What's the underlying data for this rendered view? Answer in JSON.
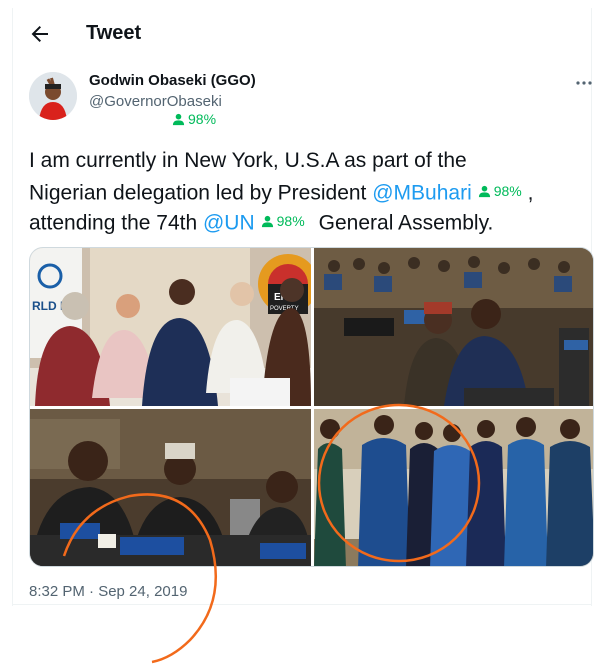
{
  "header": {
    "title": "Tweet",
    "back_icon": "back-arrow-icon"
  },
  "author": {
    "display_name": "Godwin Obaseki (GGO)",
    "handle": "@GovernorObaseki",
    "badge_percent": "98%",
    "more_icon": "more-dots-icon"
  },
  "tweet": {
    "line1": "I am currently in New York, U.S.A as part of the",
    "line2_prefix": "Nigerian delegation led by President ",
    "mention1": "@MBuhari",
    "mention1_badge": "98%",
    "line2_suffix": " ,",
    "line3_prefix": "attending the 74th ",
    "mention2": "@UN",
    "mention2_badge": "98%",
    "line3_suffix": "General Assembly."
  },
  "media": {
    "photo1_sign_left": "RLD BA",
    "photo1_sign_right_1": "END",
    "photo1_sign_right_2": "POVERTY"
  },
  "timestamp": "8:32 PM · Sep 24, 2019",
  "colors": {
    "accent": "#1d9bf0",
    "badge": "#00ba5a",
    "annotation": "#f26a1b",
    "secondary_text": "#536471"
  }
}
